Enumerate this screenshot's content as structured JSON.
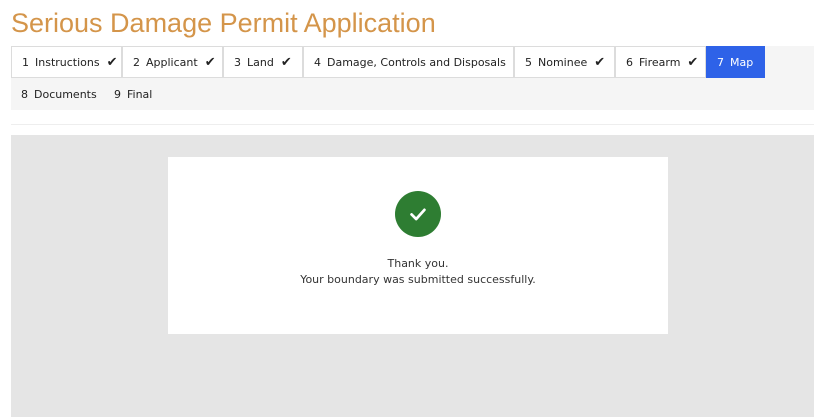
{
  "page": {
    "title": "Serious Damage Permit Application"
  },
  "tabs": [
    {
      "number": "1",
      "label": "Instructions",
      "completed": true,
      "active": false
    },
    {
      "number": "2",
      "label": "Applicant",
      "completed": true,
      "active": false
    },
    {
      "number": "3",
      "label": "Land",
      "completed": true,
      "active": false
    },
    {
      "number": "4",
      "label": "Damage, Controls and Disposals",
      "completed": true,
      "active": false
    },
    {
      "number": "5",
      "label": "Nominee",
      "completed": true,
      "active": false
    },
    {
      "number": "6",
      "label": "Firearm",
      "completed": true,
      "active": false
    },
    {
      "number": "7",
      "label": "Map",
      "completed": false,
      "active": true
    },
    {
      "number": "8",
      "label": "Documents",
      "completed": false,
      "active": false
    },
    {
      "number": "9",
      "label": "Final",
      "completed": false,
      "active": false
    }
  ],
  "check_glyph": "✔",
  "confirmation": {
    "icon": "checkmark-circle-icon",
    "line1": "Thank you.",
    "line2": "Your boundary was submitted successfully."
  },
  "colors": {
    "title": "#D4954A",
    "active_tab": "#2e62e8",
    "success": "#2e7d32",
    "panel_background": "#e5e5e5"
  }
}
